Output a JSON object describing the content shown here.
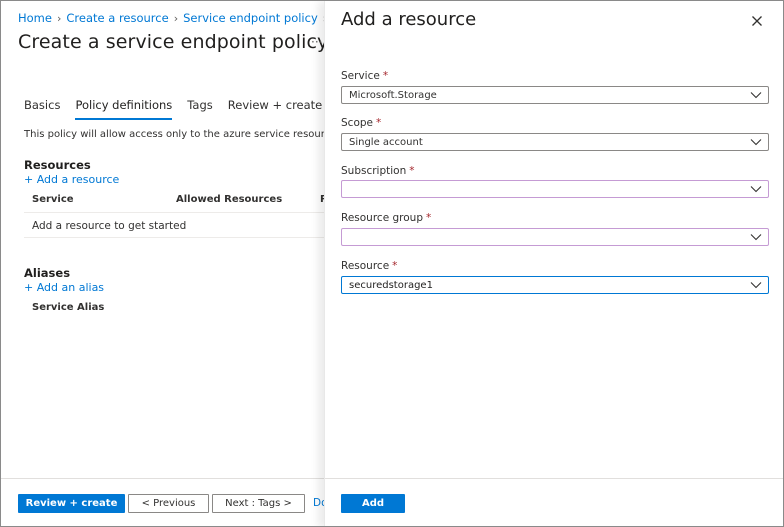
{
  "main": {
    "breadcrumb": [
      "Home",
      "Create a resource",
      "Service endpoint policy"
    ],
    "title": "Create a service endpoint policy",
    "more_label": "···",
    "tabs": [
      {
        "label": "Basics",
        "active": false
      },
      {
        "label": "Policy definitions",
        "active": true
      },
      {
        "label": "Tags",
        "active": false
      },
      {
        "label": "Review + create",
        "active": false
      }
    ],
    "description": "This policy will allow access only to the azure service resources liste",
    "resources": {
      "heading": "Resources",
      "add_link": "+ Add a resource",
      "columns": [
        "Service",
        "Allowed Resources",
        "R"
      ],
      "empty_text": "Add a resource to get started"
    },
    "aliases": {
      "heading": "Aliases",
      "add_link": "+ Add an alias",
      "columns": [
        "Service Alias"
      ]
    },
    "footer": {
      "review_create": "Review + create",
      "previous": "< Previous",
      "next": "Next : Tags >",
      "doc_link": "Do"
    }
  },
  "blade": {
    "title": "Add a resource",
    "close_icon": "close-icon",
    "required_marker": "*",
    "fields": [
      {
        "label": "Service",
        "value": "Microsoft.Storage",
        "state": "normal"
      },
      {
        "label": "Scope",
        "value": "Single account",
        "state": "normal"
      },
      {
        "label": "Subscription",
        "value": "",
        "state": "invalid"
      },
      {
        "label": "Resource group",
        "value": "",
        "state": "invalid"
      },
      {
        "label": "Resource",
        "value": "securedstorage1",
        "state": "focused"
      }
    ],
    "add_button": "Add"
  },
  "colors": {
    "accent": "#0078d4",
    "required": "#a4262c",
    "invalid_border": "#c59bd4"
  }
}
